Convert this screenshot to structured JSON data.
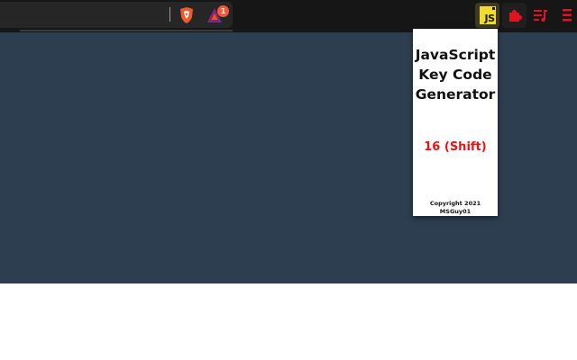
{
  "toolbar": {
    "rewards_badge_count": "1",
    "icons": {
      "shield": "brave-shield-icon",
      "rewards": "brave-rewards-icon",
      "js_extension": "js-extension-icon",
      "puzzle": "extensions-puzzle-icon",
      "playlist": "playlist-icon",
      "menu": "menu-icon"
    },
    "js_logo_text": "JS",
    "colors": {
      "toolbar_bg": "#161616",
      "accent_red": "#e0141e",
      "js_yellow": "#f0db2e"
    }
  },
  "page": {
    "background": "#2d3e50"
  },
  "popup": {
    "title_lines": [
      "JavaScript",
      "Key Code",
      "Generator"
    ],
    "keycode": "16 (Shift)",
    "copyright_lines": [
      "Copyright 2021",
      "MSGuy01"
    ],
    "keycode_color": "#ee1111"
  }
}
